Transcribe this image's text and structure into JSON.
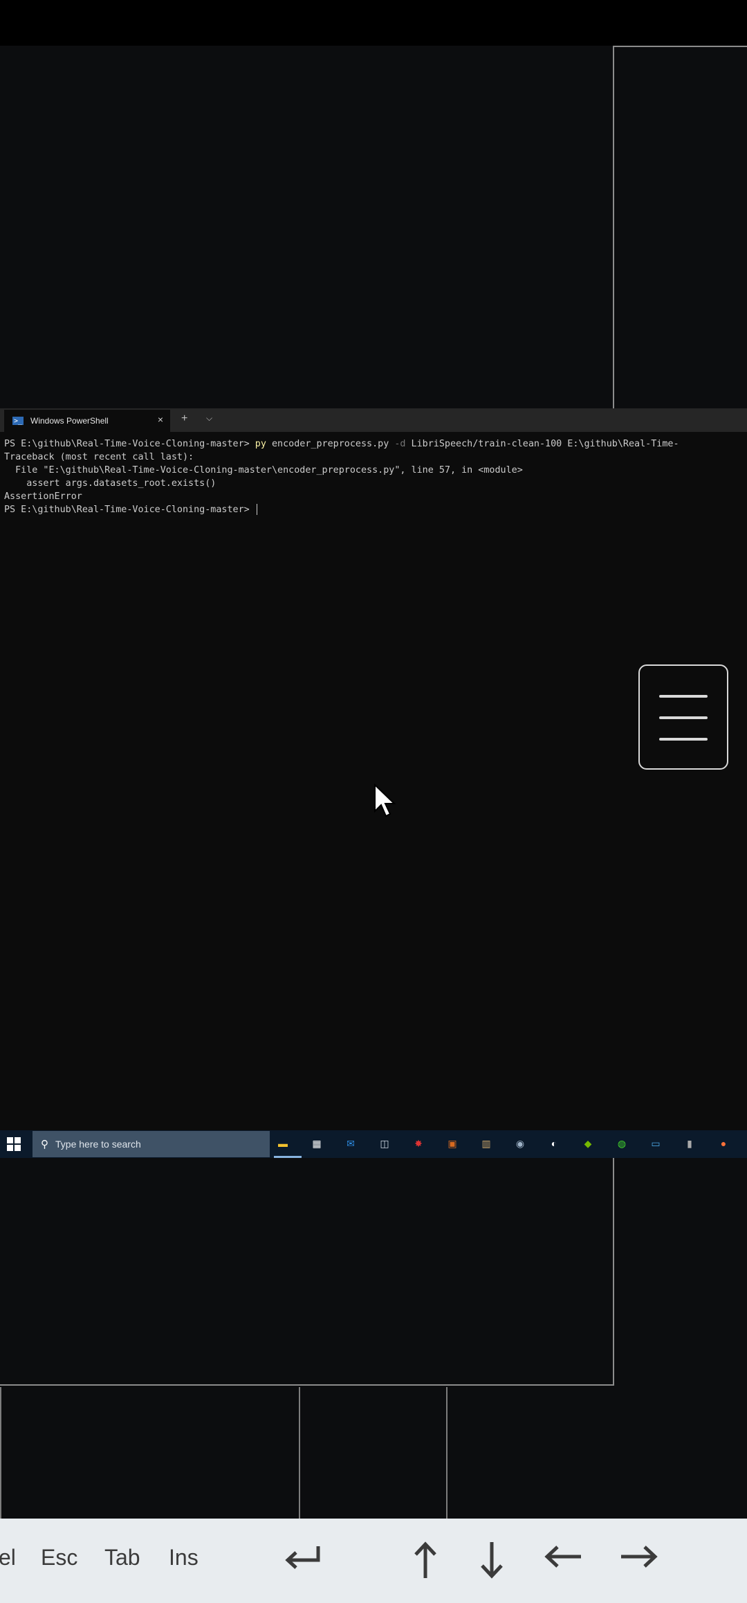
{
  "terminal": {
    "tab_title": "Windows PowerShell",
    "tab_close": "×",
    "new_tab": "+",
    "dropdown": "⌵",
    "line1_prompt": "PS E:\\github\\Real-Time-Voice-Cloning-master> ",
    "line1_cmd": "py",
    "line1_script": " encoder_preprocess.py ",
    "line1_flag": "-d",
    "line1_args": " LibriSpeech/train-clean-100 E:\\github\\Real-Time-",
    "line2": "Traceback (most recent call last):",
    "line3": "  File \"E:\\github\\Real-Time-Voice-Cloning-master\\encoder_preprocess.py\", line 57, in <module>",
    "line4": "    assert args.datasets_root.exists()",
    "line5": "AssertionError",
    "line6_prompt": "PS E:\\github\\Real-Time-Voice-Cloning-master> "
  },
  "taskbar": {
    "search_placeholder": "Type here to search",
    "search_icon": "magnifier-icon",
    "apps": [
      {
        "name": "file-explorer-icon",
        "glyph": "▬",
        "color": "#f2c12e"
      },
      {
        "name": "store-icon",
        "glyph": "▦",
        "color": "#ffffff"
      },
      {
        "name": "mail-icon",
        "glyph": "✉",
        "color": "#2e8ee6"
      },
      {
        "name": "photos-icon",
        "glyph": "◫",
        "color": "#cfd8e3"
      },
      {
        "name": "game-icon",
        "glyph": "✸",
        "color": "#d33"
      },
      {
        "name": "app-orange-icon",
        "glyph": "▣",
        "color": "#d86a1f"
      },
      {
        "name": "library-icon",
        "glyph": "▥",
        "color": "#c9a46a"
      },
      {
        "name": "camera-icon",
        "glyph": "◉",
        "color": "#9fb3c8"
      },
      {
        "name": "steam-icon",
        "glyph": "◐",
        "color": "#ffffff"
      },
      {
        "name": "nvidia-icon",
        "glyph": "◆",
        "color": "#76b900"
      },
      {
        "name": "razer-icon",
        "glyph": "◍",
        "color": "#44d62c"
      },
      {
        "name": "remote-desktop-icon",
        "glyph": "▭",
        "color": "#4aa3df"
      },
      {
        "name": "usb-icon",
        "glyph": "▮",
        "color": "#aaaaaa"
      },
      {
        "name": "firefox-icon",
        "glyph": "●",
        "color": "#ff7139"
      }
    ]
  },
  "keys": {
    "del_partial": "el",
    "esc": "Esc",
    "tab": "Tab",
    "ins": "Ins",
    "enter": "↵",
    "up": "↑",
    "down": "↓",
    "left": "←",
    "right": "→"
  }
}
